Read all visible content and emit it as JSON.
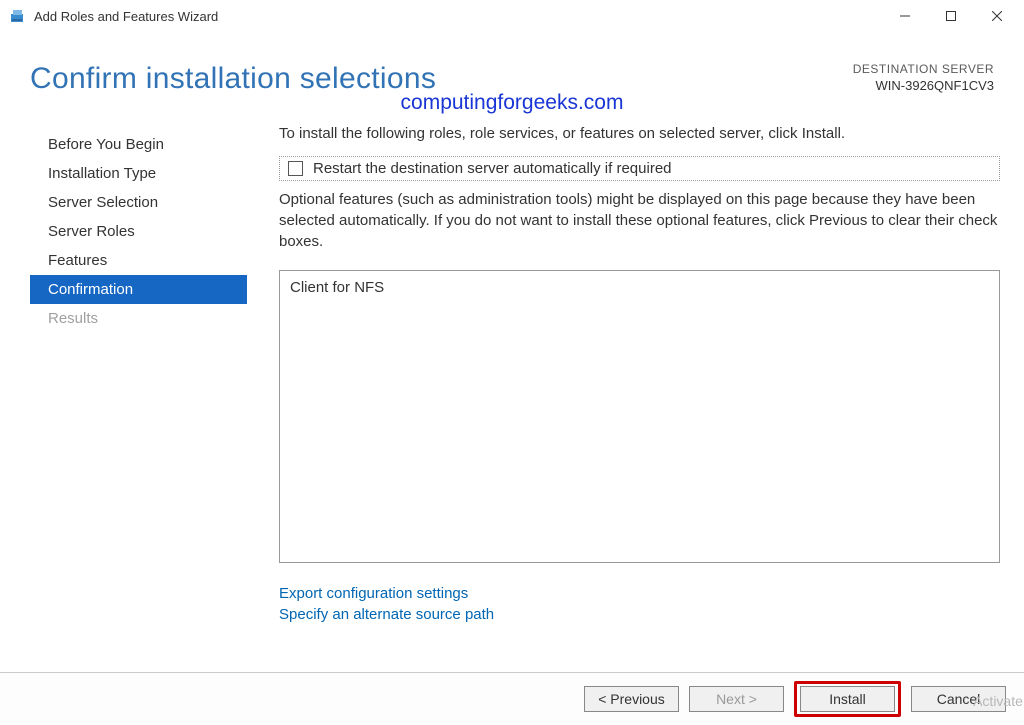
{
  "window": {
    "title": "Add Roles and Features Wizard"
  },
  "page": {
    "title": "Confirm installation selections",
    "destLabel": "DESTINATION SERVER",
    "destName": "WIN-3926QNF1CV3",
    "watermark": "computingforgeeks.com"
  },
  "sidebar": {
    "items": [
      {
        "label": "Before You Begin"
      },
      {
        "label": "Installation Type"
      },
      {
        "label": "Server Selection"
      },
      {
        "label": "Server Roles"
      },
      {
        "label": "Features"
      },
      {
        "label": "Confirmation"
      },
      {
        "label": "Results"
      }
    ]
  },
  "main": {
    "intro": "To install the following roles, role services, or features on selected server, click Install.",
    "restartLabel": "Restart the destination server automatically if required",
    "optionalText": "Optional features (such as administration tools) might be displayed on this page because they have been selected automatically. If you do not want to install these optional features, click Previous to clear their check boxes.",
    "featuresList": [
      "Client for NFS"
    ],
    "linkExport": "Export configuration settings",
    "linkSource": "Specify an alternate source path"
  },
  "buttons": {
    "previous": "< Previous",
    "next": "Next >",
    "install": "Install",
    "cancel": "Cancel"
  },
  "activateWatermark": "Activate W"
}
